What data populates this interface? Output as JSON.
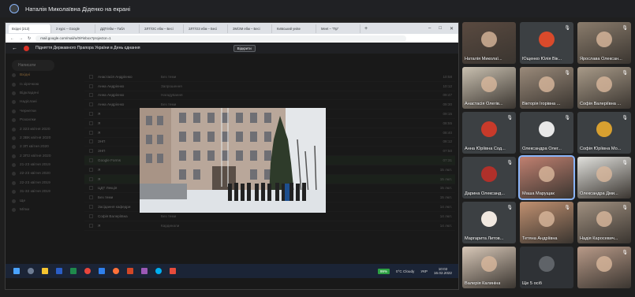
{
  "presenting": {
    "text": "Наталія Миколаївна Діденко на екрані"
  },
  "browser": {
    "tabs": [
      "Вхідні (213)",
      "2 курс – Google",
      "ДДТ/ебм – Табл",
      "ЗЛТ/ОС ебм – Бесі",
      "ЗЛТ/ОЗ ебм – Бесі",
      "ЗМ/ЗМ ебм – Бесі",
      "Київський унівe",
      "Meet – \"Пр\""
    ],
    "url": "mail.google.com/mail/u/0/#inbox?projector=1",
    "share_title": "Підняття Державного Прапора України в День єднання",
    "share_stop": "Відкрити"
  },
  "gmail": {
    "compose": "Написати",
    "folders": [
      "Вхідні",
      "Із зірочкою",
      "Відкладені",
      "Надіслані",
      "Чернетки",
      "Розсилки",
      "2 323 квітня 2020",
      "2 ЗВК квітня 2020",
      "2 ЗП квітня 2020",
      "2 ЗП2 квітня 2020",
      "21-23 квітня 2019",
      "22-23 квітня 2020",
      "22-23 квітня 2019",
      "31-32 квітня 2019",
      "Ще",
      "Мітки"
    ],
    "mails": [
      {
        "from": "Анастасія Андрієнко",
        "subj": "Без теми",
        "time": "10:58"
      },
      {
        "from": "Анна Андрієнко",
        "subj": "Запрошення",
        "time": "10:12"
      },
      {
        "from": "Анна Андрієнко",
        "subj": "Нагадування",
        "time": "09:47"
      },
      {
        "from": "Анна Андрієнко",
        "subj": "Без теми",
        "time": "09:30"
      },
      {
        "from": "Я",
        "subj": "Документ",
        "time": "09:15"
      },
      {
        "from": "Я",
        "subj": "Без теми",
        "time": "08:55"
      },
      {
        "from": "Я",
        "subj": "Звіт",
        "time": "08:40"
      },
      {
        "from": "ЗНП",
        "subj": "Розклад",
        "time": "08:12"
      },
      {
        "from": "ЗНП",
        "subj": "Оголошення",
        "time": "07:50"
      },
      {
        "from": "Google Forms",
        "subj": "Форма відповіді",
        "time": "07:31"
      },
      {
        "from": "Я",
        "subj": "Без теми",
        "time": "15 лют."
      },
      {
        "from": "Я",
        "subj": "Файл",
        "time": "15 лют."
      },
      {
        "from": "ЦДТ Лекція",
        "subj": "Відеоуроки",
        "time": "15 лют."
      },
      {
        "from": "Без теми",
        "subj": "Без теми",
        "time": "15 лют."
      },
      {
        "from": "Засідання кафедри",
        "subj": "Протокол",
        "time": "14 лют."
      },
      {
        "from": "Софія Валеріївна",
        "subj": "Без теми",
        "time": "14 лют."
      },
      {
        "from": "Я",
        "subj": "Кардинали",
        "time": "14 лют."
      }
    ]
  },
  "taskbar": {
    "battery": "99%",
    "weather": "0°C Cloudy",
    "lang": "УКР",
    "time": "10:02",
    "date": "16.02.2022"
  },
  "participants": [
    {
      "name": "Наталія Миколаї...",
      "type": "video",
      "color": "#5a4a40"
    },
    {
      "name": "Ющенко Юлія Вік...",
      "type": "avatar",
      "color": "#d94a2b",
      "muted": true
    },
    {
      "name": "Ярослава Олексан...",
      "type": "video",
      "color": "#8a7c6c",
      "muted": true
    },
    {
      "name": "Анастасія Олегів...",
      "type": "video",
      "color": "#c9c0b0"
    },
    {
      "name": "Вікторія Ігорівна ...",
      "type": "video",
      "color": "#9a8a7a",
      "muted": true
    },
    {
      "name": "Софія Валеріївна ...",
      "type": "video",
      "color": "#a89a88",
      "muted": true
    },
    {
      "name": "Анна Юріївна Сод...",
      "type": "avatar",
      "color": "#c83a2a",
      "muted": true
    },
    {
      "name": "Олександра Олег...",
      "type": "avatar",
      "color": "#e8e8e8",
      "muted": true
    },
    {
      "name": "Софія Юріївна Мо...",
      "type": "avatar",
      "color": "#d8a030",
      "muted": true
    },
    {
      "name": "Дарина Олександ...",
      "type": "avatar",
      "color": "#b0302a",
      "muted": true
    },
    {
      "name": "Маша Марущак",
      "type": "video",
      "color": "#c08070",
      "speaking": true
    },
    {
      "name": "Олександра Дми...",
      "type": "video",
      "color": "#e0e0dc",
      "muted": true
    },
    {
      "name": "Маргарита Литов...",
      "type": "avatar",
      "color": "#f0e8e0",
      "muted": true
    },
    {
      "name": "Тетяна Андріївна",
      "type": "video",
      "color": "#c09070",
      "muted": true
    },
    {
      "name": "Надія Каросевич...",
      "type": "video",
      "color": "#a09080",
      "muted": true
    },
    {
      "name": "Валерія Калиніна",
      "type": "video",
      "color": "#d8c8b8"
    },
    {
      "name": "Ще 5 осіб",
      "type": "more",
      "color": "#2f3236"
    },
    {
      "name": "",
      "type": "video",
      "color": "#b89a88",
      "muted": true
    }
  ]
}
